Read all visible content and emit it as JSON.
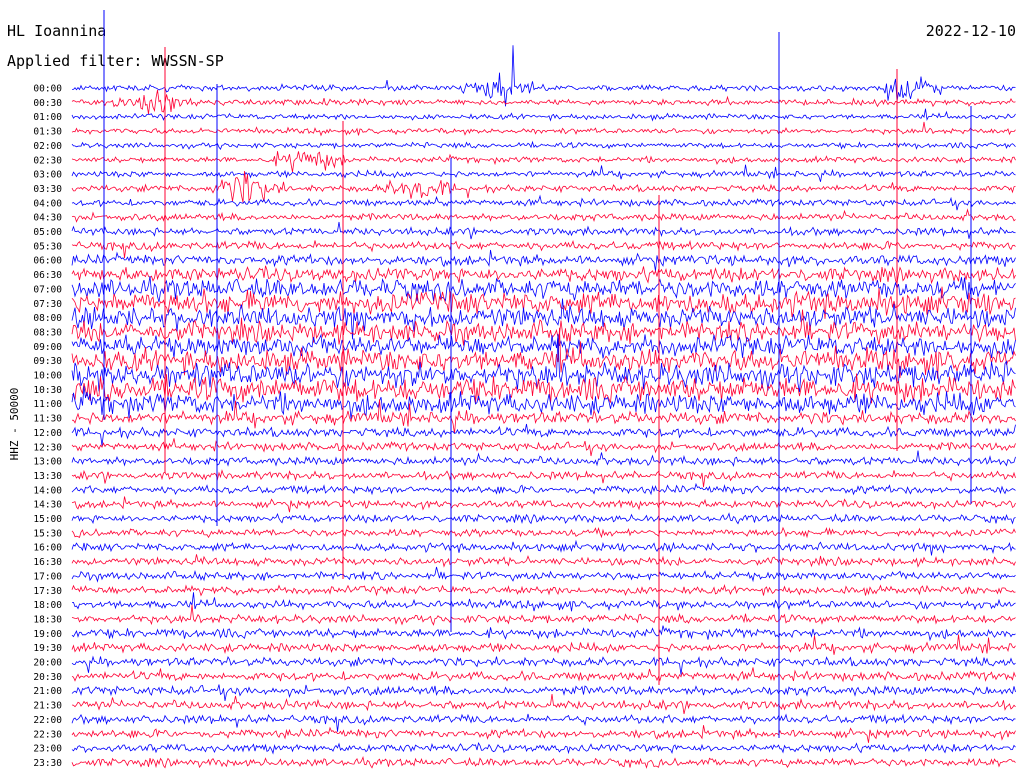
{
  "header": {
    "station": "HL Ioannina",
    "filter": "Applied filter: WWSSN-SP",
    "date": "2022-12-10"
  },
  "chart_data": {
    "type": "line",
    "title": "HL Ioannina",
    "subtitle": "Applied filter: WWSSN-SP",
    "ylabel": "HHZ - 50000",
    "date": "2022-12-10",
    "row_labels": [
      "00:00",
      "00:30",
      "01:00",
      "01:30",
      "02:00",
      "02:30",
      "03:00",
      "03:30",
      "04:00",
      "04:30",
      "05:00",
      "05:30",
      "06:00",
      "06:30",
      "07:00",
      "07:30",
      "08:00",
      "08:30",
      "09:00",
      "09:30",
      "10:00",
      "10:30",
      "11:00",
      "11:30",
      "12:00",
      "12:30",
      "13:00",
      "13:30",
      "14:00",
      "14:30",
      "15:00",
      "15:30",
      "16:00",
      "16:30",
      "17:00",
      "17:30",
      "18:00",
      "18:30",
      "19:00",
      "19:30",
      "20:00",
      "20:30",
      "21:00",
      "21:30",
      "22:00",
      "22:30",
      "23:00",
      "23:30"
    ],
    "row_colors": [
      "#0000ff",
      "#ff0033"
    ],
    "row_activity": [
      0.06,
      0.06,
      0.05,
      0.05,
      0.05,
      0.06,
      0.07,
      0.08,
      0.08,
      0.09,
      0.1,
      0.12,
      0.16,
      0.25,
      0.38,
      0.45,
      0.42,
      0.4,
      0.4,
      0.45,
      0.5,
      0.5,
      0.42,
      0.22,
      0.14,
      0.12,
      0.12,
      0.11,
      0.11,
      0.1,
      0.1,
      0.1,
      0.11,
      0.11,
      0.11,
      0.11,
      0.12,
      0.12,
      0.14,
      0.13,
      0.13,
      0.13,
      0.14,
      0.13,
      0.12,
      0.12,
      0.11,
      0.11
    ],
    "events": [
      {
        "label": "00:00",
        "minute": 13.5,
        "strength": 2.2
      },
      {
        "label": "00:00",
        "minute": 26.5,
        "strength": 2.0
      },
      {
        "label": "00:30",
        "minute": 2.5,
        "strength": 1.5
      },
      {
        "label": "02:30",
        "minute": 7.5,
        "strength": 1.8
      },
      {
        "label": "03:30",
        "minute": 5.5,
        "strength": 2.4
      },
      {
        "label": "03:30",
        "minute": 11.0,
        "strength": 1.6
      }
    ]
  },
  "colors": {
    "blue": "#0000ff",
    "red": "#ff0033",
    "text": "#000000",
    "background": "#ffffff"
  }
}
